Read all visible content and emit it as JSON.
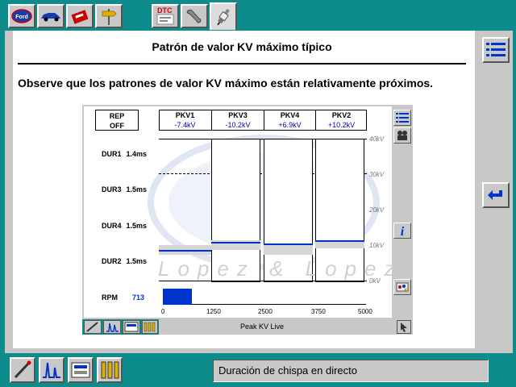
{
  "toolbar": {
    "dtc_label": "DTC",
    "colors": {
      "teal": "#0e8b8b",
      "panel": "#c8c8c8",
      "blue": "#0033cc"
    }
  },
  "page": {
    "title": "Patrón de valor KV máximo típico",
    "description": "Observe que los patrones de valor KV máximo están relativamente próximos."
  },
  "scope": {
    "rep_label": "REP",
    "rep_value": "OFF",
    "columns": [
      {
        "name": "PKV1",
        "value": "-7.4kV"
      },
      {
        "name": "PKV3",
        "value": "-10.2kV"
      },
      {
        "name": "PKV4",
        "value": "+6.9kV"
      },
      {
        "name": "PKV2",
        "value": "+10.2kV"
      }
    ],
    "durations": [
      {
        "label": "DUR1",
        "value": "1.4ms"
      },
      {
        "label": "DUR3",
        "value": "1.5ms"
      },
      {
        "label": "DUR4",
        "value": "1.5ms"
      },
      {
        "label": "DUR2",
        "value": "1.5ms"
      }
    ],
    "kv_scale": [
      "40kV",
      "30kV",
      "20kV",
      "10kV",
      "0kV"
    ],
    "watermark": "Lopez & Lopez",
    "rpm_label": "RPM",
    "rpm_value": "713",
    "rpm_fraction": 0.1426,
    "rpm_ticks": [
      "0",
      "1250",
      "2500",
      "3750",
      "5000"
    ],
    "status_text": "Peak KV Live"
  },
  "status": {
    "text": "Duración de chispa en directo"
  }
}
